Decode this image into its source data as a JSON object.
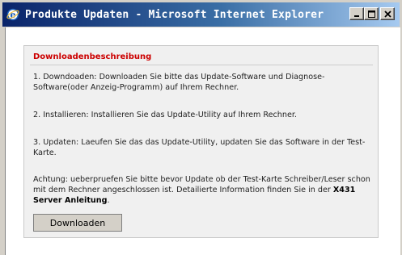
{
  "window": {
    "title": "Produkte Updaten - Microsoft Internet Explorer",
    "minimize_label": "_",
    "maximize_label": "□",
    "close_label": "✕"
  },
  "panel": {
    "title": "Downloadenbeschreibung",
    "step1": "1. Downdoaden: Downloaden Sie bitte das Update-Software und Diagnose-Software(oder Anzeig-Programm) auf Ihrem Rechner.",
    "step2": "2. Installieren: Installieren Sie das Update-Utility auf Ihrem Rechner.",
    "step3": "3. Updaten: Laeufen Sie das das Update-Utility, updaten Sie das Software in der Test-Karte.",
    "note_text": "Achtung: ueberpruefen Sie bitte bevor Update ob der Test-Karte Schreiber/Leser schon mit dem Rechner angeschlossen ist. Detailierte Information finden Sie in der ",
    "note_link": "X431 Server Anleitung",
    "note_end": ".",
    "download_button": "Downloaden"
  },
  "icons": {
    "app": "internet-explorer-icon"
  }
}
